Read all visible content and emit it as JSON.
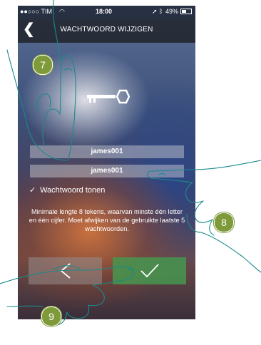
{
  "statusbar": {
    "carrier": "●●○○○ TIM",
    "time": "18:00",
    "battery": "49%"
  },
  "navbar": {
    "back_icon": "chevron-left-icon",
    "title": "WACHTWOORD WIJZIGEN"
  },
  "fields": {
    "password": "james001",
    "password_confirm": "james001"
  },
  "show_password": {
    "checked": true,
    "label": "Wachtwoord tonen"
  },
  "hint": "Minimale lengte 8 tekens, waarvan minste één letter en één cijfer. Moet afwijken van de gebruikte laatste 5 wachtwoorden.",
  "buttons": {
    "back_icon": "chevron-left-icon",
    "confirm_icon": "checkmark-icon"
  },
  "steps": [
    "7",
    "8",
    "9"
  ],
  "colors": {
    "step_badge": "#7e9a3a",
    "confirm_button": "#4a9650"
  }
}
